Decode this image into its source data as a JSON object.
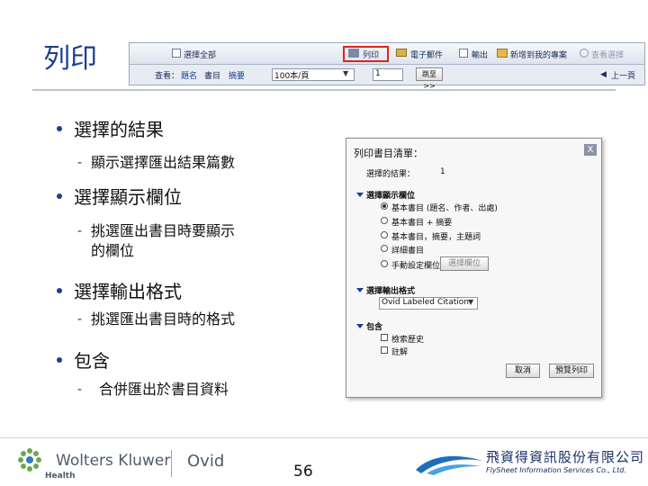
{
  "slide": {
    "title": "列印",
    "page_number": "56"
  },
  "toolbar": {
    "select_all": "選擇全部",
    "print": "列印",
    "email": "電子郵件",
    "export": "輸出",
    "add_to_folder": "新增到我的專案",
    "view_selected": "查看選擇",
    "view_label": "查看：",
    "view_options": [
      "題名",
      "書目",
      "摘要"
    ],
    "per_page": "100本/頁",
    "page_value": "1",
    "go": "跳至 >>",
    "prev_page": "上一頁"
  },
  "bullets": [
    {
      "heading": "選擇的結果",
      "sub": "顯示選擇匯出結果篇數"
    },
    {
      "heading": "選擇顯示欄位",
      "sub_lines": [
        "挑選匯出書目時要顯示",
        "的欄位"
      ]
    },
    {
      "heading": "選擇輸出格式",
      "sub": "挑選匯出書目時的格式"
    },
    {
      "heading": "包含",
      "sub": "合併匯出於書目資料"
    }
  ],
  "dialog": {
    "title": "列印書目清單：",
    "close": "X",
    "selected_label": "選擇的結果：",
    "selected_value": "1",
    "fields_section": "選擇顯示欄位",
    "field_options": [
      {
        "label": "基本書目 (題名、作者、出處)",
        "selected": true
      },
      {
        "label": "基本書目 + 摘要",
        "selected": false
      },
      {
        "label": "基本書目，摘要，主題詞",
        "selected": false
      },
      {
        "label": "詳細書目",
        "selected": false
      },
      {
        "label": "手動設定欄位",
        "selected": false
      }
    ],
    "select_fields_button": "選擇欄位",
    "format_section": "選擇輸出格式",
    "format_value": "Ovid Labeled Citation",
    "include_section": "包含",
    "include_options": [
      "檢索歷史",
      "註解"
    ],
    "cancel": "取消",
    "preview": "預覽列印"
  },
  "footer": {
    "brand": "Wolters Kluwer",
    "brand_sub": "Health",
    "product": "Ovid",
    "partner": "飛資得資訊股份有限公司",
    "partner_sub": "FlySheet Information Services Co., Ltd."
  },
  "colors": {
    "title": "#1b3f8f",
    "highlight": "#e2231a",
    "bullet": "#1b3f8f"
  }
}
